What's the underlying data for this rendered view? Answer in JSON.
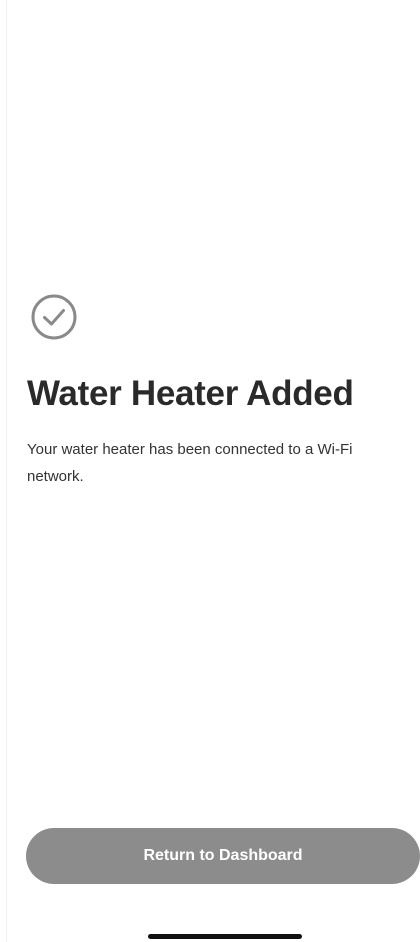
{
  "confirmation": {
    "icon": "check-circle-icon",
    "title": "Water Heater Added",
    "message": "Your water heater has been connected to a Wi-Fi network."
  },
  "actions": {
    "return_label": "Return to Dashboard"
  },
  "colors": {
    "button_background": "#8c8c8c",
    "button_text": "#ffffff",
    "icon": "#8a8a8a",
    "title_text": "#2a2a2a",
    "background": "#ffffff"
  }
}
